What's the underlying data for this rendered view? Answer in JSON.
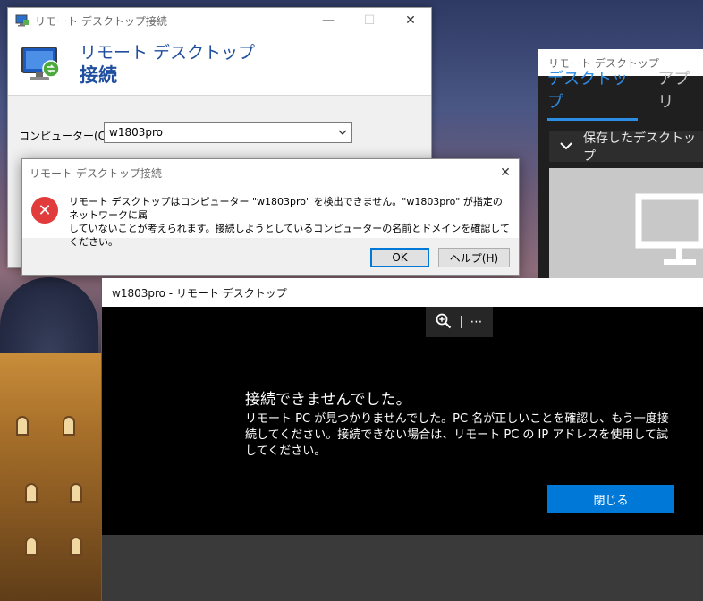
{
  "rdc_window": {
    "title": "リモート デスクトップ接続",
    "banner_line1": "リモート デスクトップ",
    "banner_line2": "接続",
    "computer_label": "コンピューター(C):",
    "computer_value": "w1803pro",
    "minimize": "—",
    "maximize": "☐",
    "close": "✕"
  },
  "error_dialog": {
    "title": "リモート デスクトップ接続",
    "message_line1": "リモート デスクトップはコンピューター \"w1803pro\" を検出できません。\"w1803pro\" が指定のネットワークに属",
    "message_line2": "していないことが考えられます。接続しようとしているコンピューターの名前とドメインを確認してください。",
    "ok_label": "OK",
    "help_label": "ヘルプ(H)",
    "close": "✕",
    "error_glyph": "✕"
  },
  "rdapp": {
    "title": "リモート デスクトップ",
    "tabs": [
      {
        "label": "デスクトップ",
        "active": true
      },
      {
        "label": "アプリ",
        "active": false
      }
    ],
    "section_label": "保存したデスクトップ"
  },
  "session": {
    "title": "w1803pro - リモート デスクトップ",
    "heading": "接続できませんでした。",
    "body": "リモート PC が見つかりませんでした。PC 名が正しいことを確認し、もう一度接続してください。接続できない場合は、リモート PC の IP アドレスを使用して試してください。",
    "close_label": "閉じる",
    "more_glyph": "⋯"
  },
  "colors": {
    "accent_blue": "#0078d7",
    "banner_blue": "#1f4e9e",
    "error_red": "#e23b3b",
    "tab_active": "#2d8ce3"
  }
}
